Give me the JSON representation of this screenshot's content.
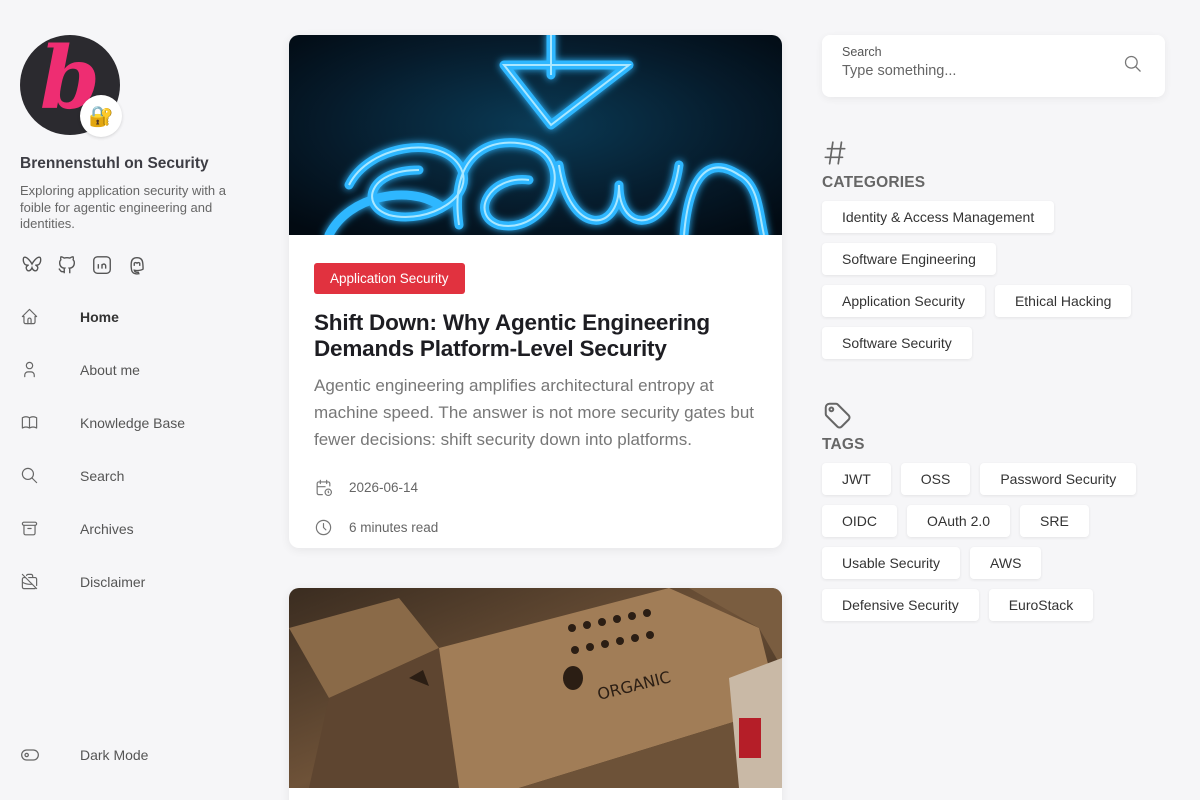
{
  "site": {
    "title": "Brennenstuhl on Security",
    "description": "Exploring application security with a foible for agentic engineering and identities.",
    "avatar_letter": "b",
    "avatar_badge": "🔐",
    "social": [
      "bluesky-icon",
      "github-icon",
      "linkedin-icon",
      "mastodon-icon"
    ]
  },
  "nav": {
    "items": [
      {
        "label": "Home",
        "icon": "home-icon",
        "active": true
      },
      {
        "label": "About me",
        "icon": "user-icon"
      },
      {
        "label": "Knowledge Base",
        "icon": "book-icon"
      },
      {
        "label": "Search",
        "icon": "search-icon"
      },
      {
        "label": "Archives",
        "icon": "archive-icon"
      },
      {
        "label": "Disclaimer",
        "icon": "briefcase-off-icon"
      }
    ],
    "dark_mode": "Dark Mode"
  },
  "posts": [
    {
      "category": "Application Security",
      "title": "Shift Down: Why Agentic Engineering Demands Platform-Level Security",
      "excerpt": "Agentic engineering amplifies architectural entropy at machine speed. The answer is not more security gates but fewer decisions: shift security down into platforms.",
      "date": "2026-06-14",
      "read_time": "6 minutes read"
    }
  ],
  "search": {
    "label": "Search",
    "placeholder": "Type something..."
  },
  "categories": {
    "title": "CATEGORIES",
    "items": [
      "Identity & Access Management",
      "Software Engineering",
      "Application Security",
      "Ethical Hacking",
      "Software Security"
    ]
  },
  "tags": {
    "title": "TAGS",
    "items": [
      "JWT",
      "OSS",
      "Password Security",
      "OIDC",
      "OAuth 2.0",
      "SRE",
      "Usable Security",
      "AWS",
      "Defensive Security",
      "EuroStack"
    ]
  },
  "colors": {
    "accent": "#e1323f",
    "brand_pink": "#ee2d72",
    "background": "#f6f6f8"
  }
}
